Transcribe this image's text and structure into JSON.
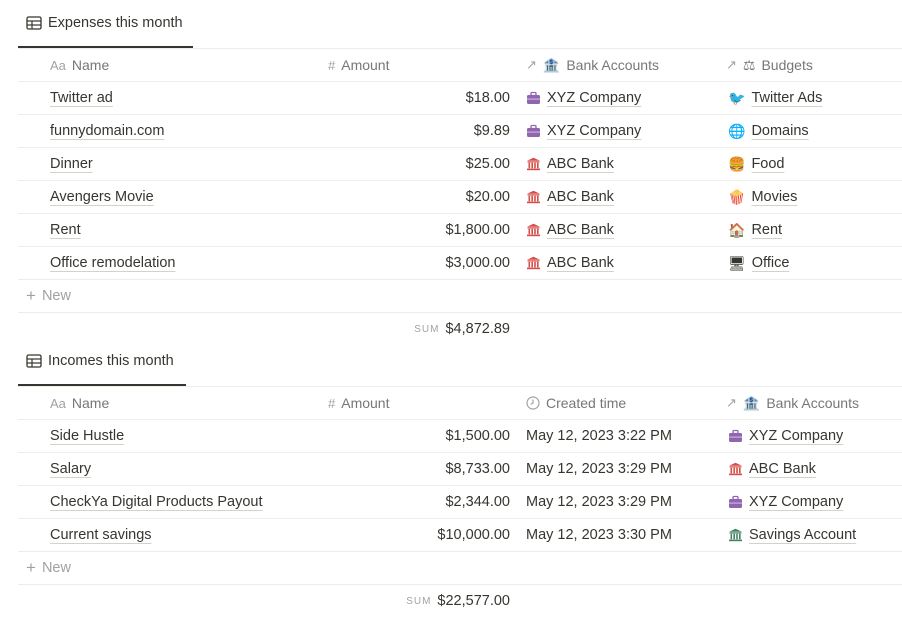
{
  "expenses": {
    "tab_label": "Expenses this month",
    "headers": {
      "name": "Name",
      "amount": "Amount",
      "bank": "Bank Accounts",
      "budget": "Budgets"
    },
    "header_icons": {
      "name": "Aa",
      "amount": "#",
      "relation": "↗"
    },
    "rows": [
      {
        "name": "Twitter ad",
        "amount": "$18.00",
        "bank": "XYZ Company",
        "bank_icon": "💼",
        "budget": "Twitter Ads",
        "budget_icon": "🐦"
      },
      {
        "name": "funnydomain.com",
        "amount": "$9.89",
        "bank": "XYZ Company",
        "bank_icon": "💼",
        "budget": "Domains",
        "budget_icon": "🌐"
      },
      {
        "name": "Dinner",
        "amount": "$25.00",
        "bank": "ABC Bank",
        "bank_icon": "🏛",
        "budget": "Food",
        "budget_icon": "🍔"
      },
      {
        "name": "Avengers Movie",
        "amount": "$20.00",
        "bank": "ABC Bank",
        "bank_icon": "🏛",
        "budget": "Movies",
        "budget_icon": "🍿"
      },
      {
        "name": "Rent",
        "amount": "$1,800.00",
        "bank": "ABC Bank",
        "bank_icon": "🏛",
        "budget": "Rent",
        "budget_icon": "🏠"
      },
      {
        "name": "Office remodelation",
        "amount": "$3,000.00",
        "bank": "ABC Bank",
        "bank_icon": "🏛",
        "budget": "Office",
        "budget_icon": "🖥"
      }
    ],
    "new_label": "New",
    "sum_label": "SUM",
    "sum_value": "$4,872.89"
  },
  "incomes": {
    "tab_label": "Incomes this month",
    "headers": {
      "name": "Name",
      "amount": "Amount",
      "created": "Created time",
      "bank": "Bank Accounts"
    },
    "header_icons": {
      "name": "Aa",
      "amount": "#",
      "relation": "↗",
      "clock": "clock-icon"
    },
    "rows": [
      {
        "name": "Side Hustle",
        "amount": "$1,500.00",
        "created": "May 12, 2023 3:22 PM",
        "bank": "XYZ Company",
        "bank_icon": "💼"
      },
      {
        "name": "Salary",
        "amount": "$8,733.00",
        "created": "May 12, 2023 3:29 PM",
        "bank": "ABC Bank",
        "bank_icon": "🏛"
      },
      {
        "name": "CheckYa Digital Products Payout",
        "amount": "$2,344.00",
        "created": "May 12, 2023 3:29 PM",
        "bank": "XYZ Company",
        "bank_icon": "💼"
      },
      {
        "name": "Current savings",
        "amount": "$10,000.00",
        "created": "May 12, 2023 3:30 PM",
        "bank": "Savings Account",
        "bank_icon": "🏛"
      }
    ],
    "new_label": "New",
    "sum_label": "SUM",
    "sum_value": "$22,577.00"
  },
  "colors": {
    "text": "#37352f",
    "muted": "#787774",
    "faint": "#a3a29e",
    "border": "#ededeb",
    "xyz": "#9065b0",
    "abc": "#d44c47",
    "savings": "#448361"
  }
}
